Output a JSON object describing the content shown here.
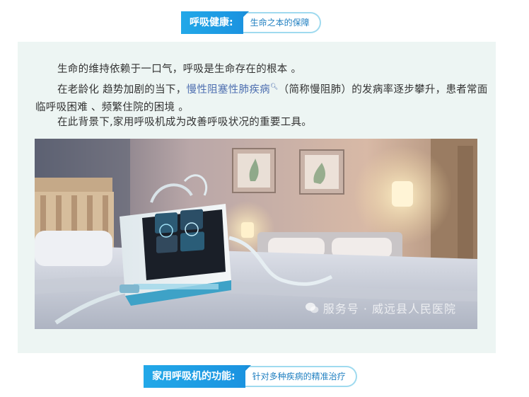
{
  "header": {
    "badge": "呼吸健康:",
    "tag": "生命之本的保障"
  },
  "article": {
    "paragraph1": "生命的维持依赖于一口气，呼吸是生命存在的根本 。",
    "paragraph2_before": "在老龄化 趋势加剧的当下，",
    "paragraph2_link": "慢性阻塞性肺疾病",
    "paragraph2_after": "（简称慢阻肺）的发病率逐步攀升，患者常面临呼吸困难 、频繁住院的困境 。",
    "paragraph3": "在此背景下,家用呼吸机成为改善呼吸状况的重要工具。"
  },
  "image": {
    "subject": "home-ventilator-bedroom",
    "watermark": "服务号 · 威远县人民医院"
  },
  "footer": {
    "badge": "家用呼吸机的功能:",
    "tag": "针对多种疾病的精准治疗"
  },
  "colors": {
    "accent": "#1b93e0",
    "panel_bg": "#edf5f3",
    "link": "#4e6fb0"
  }
}
